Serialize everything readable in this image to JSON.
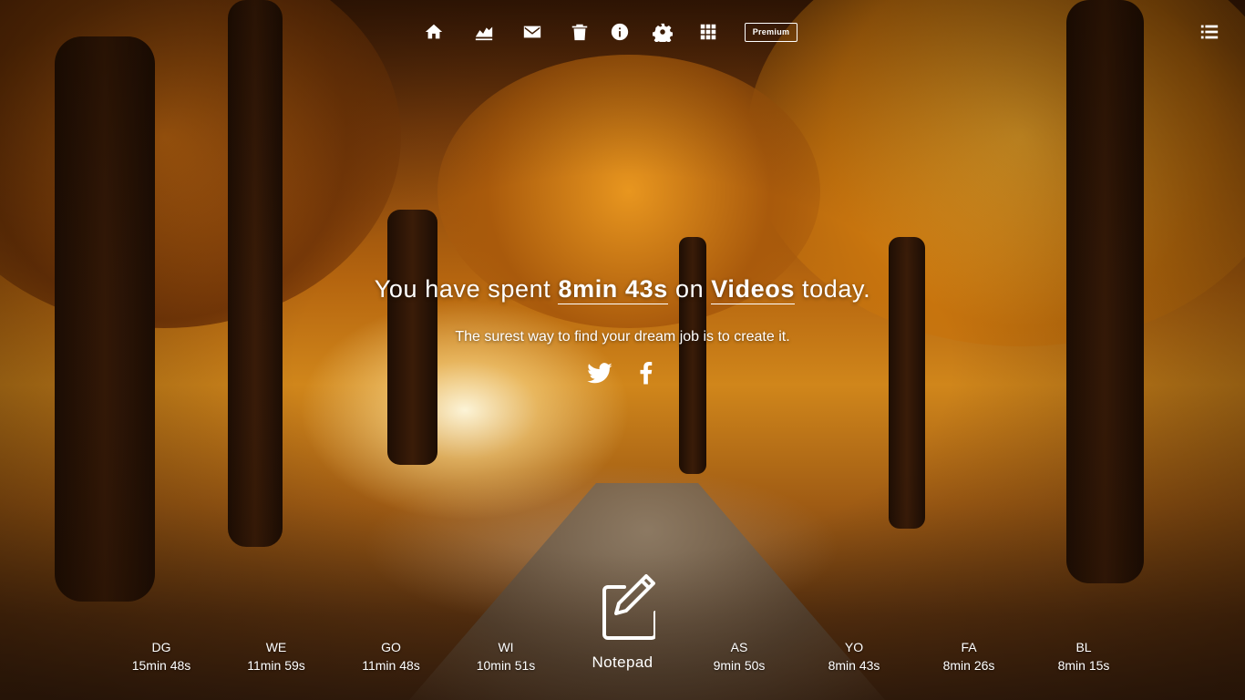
{
  "nav": {
    "icons": [
      "home-icon",
      "stats-icon",
      "mail-icon",
      "trash-icon",
      "info-icon",
      "settings-icon",
      "apps-grid-icon",
      "list-menu-icon"
    ],
    "premium_label": "Premium"
  },
  "headline": {
    "prefix": "You have spent",
    "time": "8min 43s",
    "middle": "on",
    "category": "Videos",
    "suffix": "today."
  },
  "quote": "The surest way to find your dream job is to create it.",
  "social": [
    "twitter-icon",
    "facebook-icon"
  ],
  "notepad": {
    "label": "Notepad",
    "icon": "notepad-edit-icon"
  },
  "stats": [
    {
      "code": "DG",
      "time": "15min 48s"
    },
    {
      "code": "WE",
      "time": "11min 59s"
    },
    {
      "code": "GO",
      "time": "11min 48s"
    },
    {
      "code": "WI",
      "time": "10min 51s"
    },
    {
      "code": "AS",
      "time": "9min 50s"
    },
    {
      "code": "YO",
      "time": "8min 43s"
    },
    {
      "code": "FA",
      "time": "8min 26s"
    },
    {
      "code": "BL",
      "time": "8min 15s"
    }
  ]
}
